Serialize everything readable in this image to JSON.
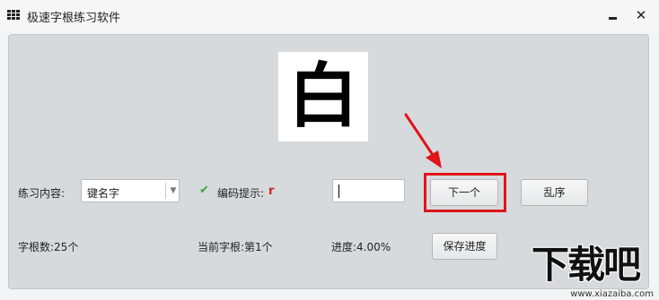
{
  "window": {
    "title": "极速字根练习软件",
    "app_icon": "grid-icon",
    "minimize_icon": "minimize-icon",
    "close_icon": "close-icon",
    "close_glyph": "✕"
  },
  "practice": {
    "current_character": "白",
    "content_label": "练习内容:",
    "content_value": "键名字",
    "hint_checked": true,
    "hint_label": "编码提示:",
    "hint_value": "r",
    "answer_value": "",
    "next_button": "下一个",
    "shuffle_button": "乱序"
  },
  "status": {
    "root_count": "字根数:25个",
    "current_root": "当前字根:第1个",
    "progress": "进度:4.00%",
    "save_button": "保存进度"
  },
  "annotation": {
    "highlight_color": "#e0141a"
  },
  "watermark": {
    "logo_text": "下载吧",
    "url": "www.xiazaiba.com"
  }
}
